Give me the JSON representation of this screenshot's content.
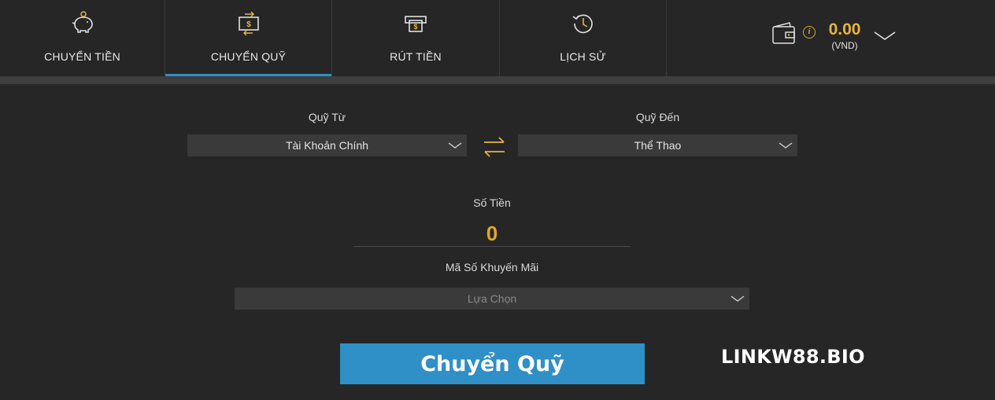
{
  "nav": {
    "tabs": [
      {
        "label": "CHUYỂN TIỀN",
        "icon": "piggy-bank-icon"
      },
      {
        "label": "CHUYỂN QUỸ",
        "icon": "money-transfer-icon"
      },
      {
        "label": "RÚT TIỀN",
        "icon": "cash-withdraw-icon"
      },
      {
        "label": "LỊCH SỬ",
        "icon": "history-clock-icon"
      }
    ],
    "active_tab": "CHUYỂN QUỸ"
  },
  "wallet": {
    "amount": "0.00",
    "currency": "(VND)",
    "info_glyph": "i"
  },
  "form": {
    "from_label": "Quỹ Từ",
    "from_value": "Tài Khoản Chính",
    "to_label": "Quỹ Đến",
    "to_value": "Thể Thao",
    "amount_label": "Số Tiền",
    "amount_value": "0",
    "promo_label": "Mã Số Khuyến Mãi",
    "promo_placeholder": "Lựa Chọn",
    "submit_label": "Chuyển Quỹ"
  },
  "watermark": "LINKW88.BIO",
  "colors": {
    "background": "#262626",
    "accent_blue": "#2f8fc7",
    "accent_gold": "#e8b43c"
  }
}
